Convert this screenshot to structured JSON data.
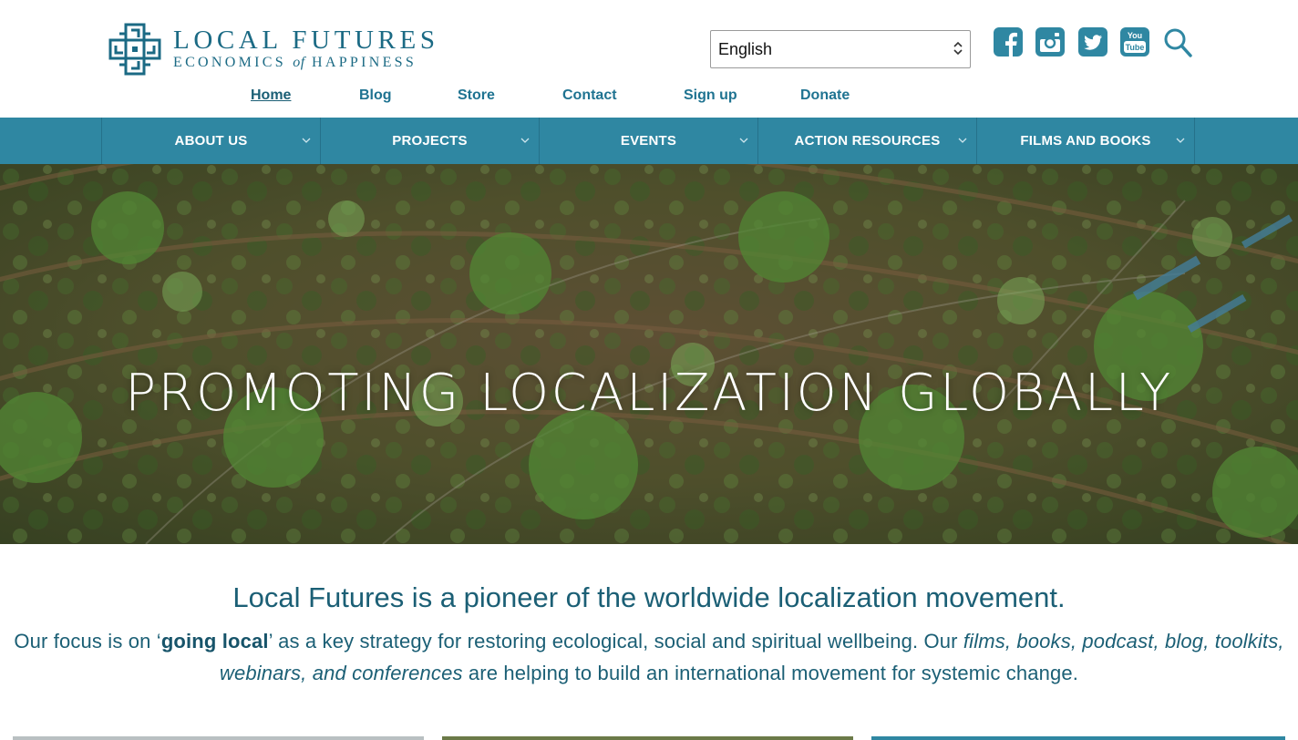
{
  "logo": {
    "title": "LOCAL FUTURES",
    "subtitle_left": "ECONOMICS",
    "subtitle_mid": "of",
    "subtitle_right": "HAPPINESS"
  },
  "language": {
    "selected": "English"
  },
  "social": [
    "facebook-icon",
    "instagram-icon",
    "twitter-icon",
    "youtube-icon"
  ],
  "top_nav": [
    {
      "label": "Home",
      "active": true
    },
    {
      "label": "Blog"
    },
    {
      "label": "Store"
    },
    {
      "label": "Contact"
    },
    {
      "label": "Sign up"
    },
    {
      "label": "Donate"
    }
  ],
  "main_nav": [
    {
      "label": "ABOUT US"
    },
    {
      "label": "PROJECTS"
    },
    {
      "label": "EVENTS"
    },
    {
      "label": "ACTION RESOURCES"
    },
    {
      "label": "FILMS AND BOOKS"
    }
  ],
  "hero": {
    "title": "PROMOTING LOCALIZATION GLOBALLY"
  },
  "intro": {
    "heading": "Local Futures is a pioneer of the worldwide localization movement.",
    "p1": "Our focus is on ‘",
    "p_bold": "going local",
    "p2": "’ as a key strategy for restoring ecological, social and spiritual wellbeing. Our ",
    "p_italic": "films, books, podcast, blog, toolkits, webinars, and conferences",
    "p3": " are helping to build an international movement for systemic change."
  },
  "colors": {
    "brand": "#1b6a84",
    "nav_bar": "#2f87a2",
    "link": "#1f7391",
    "text": "#1b5f75"
  }
}
